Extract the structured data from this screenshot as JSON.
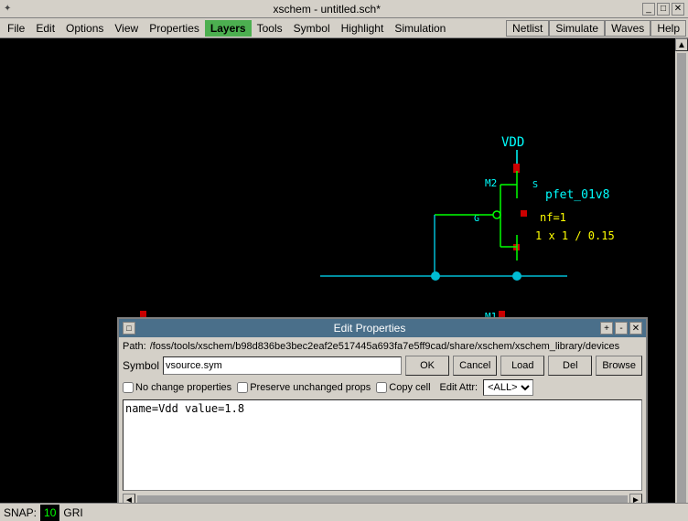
{
  "titlebar": {
    "icon": "✦",
    "title": "xschem - untitled.sch*",
    "controls": [
      "_",
      "□",
      "✕"
    ]
  },
  "menubar": {
    "items": [
      "File",
      "Edit",
      "Options",
      "View",
      "Properties",
      "Layers",
      "Tools",
      "Symbol",
      "Highlight",
      "Simulation"
    ],
    "active_index": 5,
    "right_items": [
      "Netlist",
      "Simulate",
      "Waves",
      "Help"
    ]
  },
  "schematic": {
    "vdd_label": "VDD",
    "m2_label": "M2",
    "pfet_label": "pfet_01v8",
    "nf_label": "nf=1",
    "size_label": "1 x 1 / 0.15",
    "m1_label": "M1"
  },
  "dialog": {
    "title": "Edit Properties",
    "icon": "□",
    "controls": [
      "+",
      "-",
      "✕"
    ],
    "path_label": "Path:",
    "path_value": "/foss/tools/xschem/b98d836be3bec2eaf2e517445a693fa7e5ff9cad/share/xschem/xschem_library/devices",
    "symbol_label": "Symbol",
    "symbol_value": "vsource.sym",
    "buttons": {
      "ok": "OK",
      "cancel": "Cancel",
      "load": "Load",
      "del": "Del",
      "browse": "Browse"
    },
    "options": {
      "no_change": "No change properties",
      "preserve": "Preserve unchanged props",
      "copy_cell": "Copy cell"
    },
    "edit_attr_label": "Edit Attr:",
    "edit_attr_value": "<ALL>",
    "textarea_content": "name=Vdd value=1.8"
  },
  "statusbar": {
    "snap_label": "SNAP:",
    "snap_value": "10",
    "grid_label": "GRI"
  },
  "colors": {
    "background": "#000000",
    "cyan": "#00ffff",
    "green": "#00ff00",
    "yellow": "#ffff00",
    "red_dot": "#ff0000",
    "wire_cyan": "#00bcd4",
    "pfet_outline": "#00ff00"
  }
}
